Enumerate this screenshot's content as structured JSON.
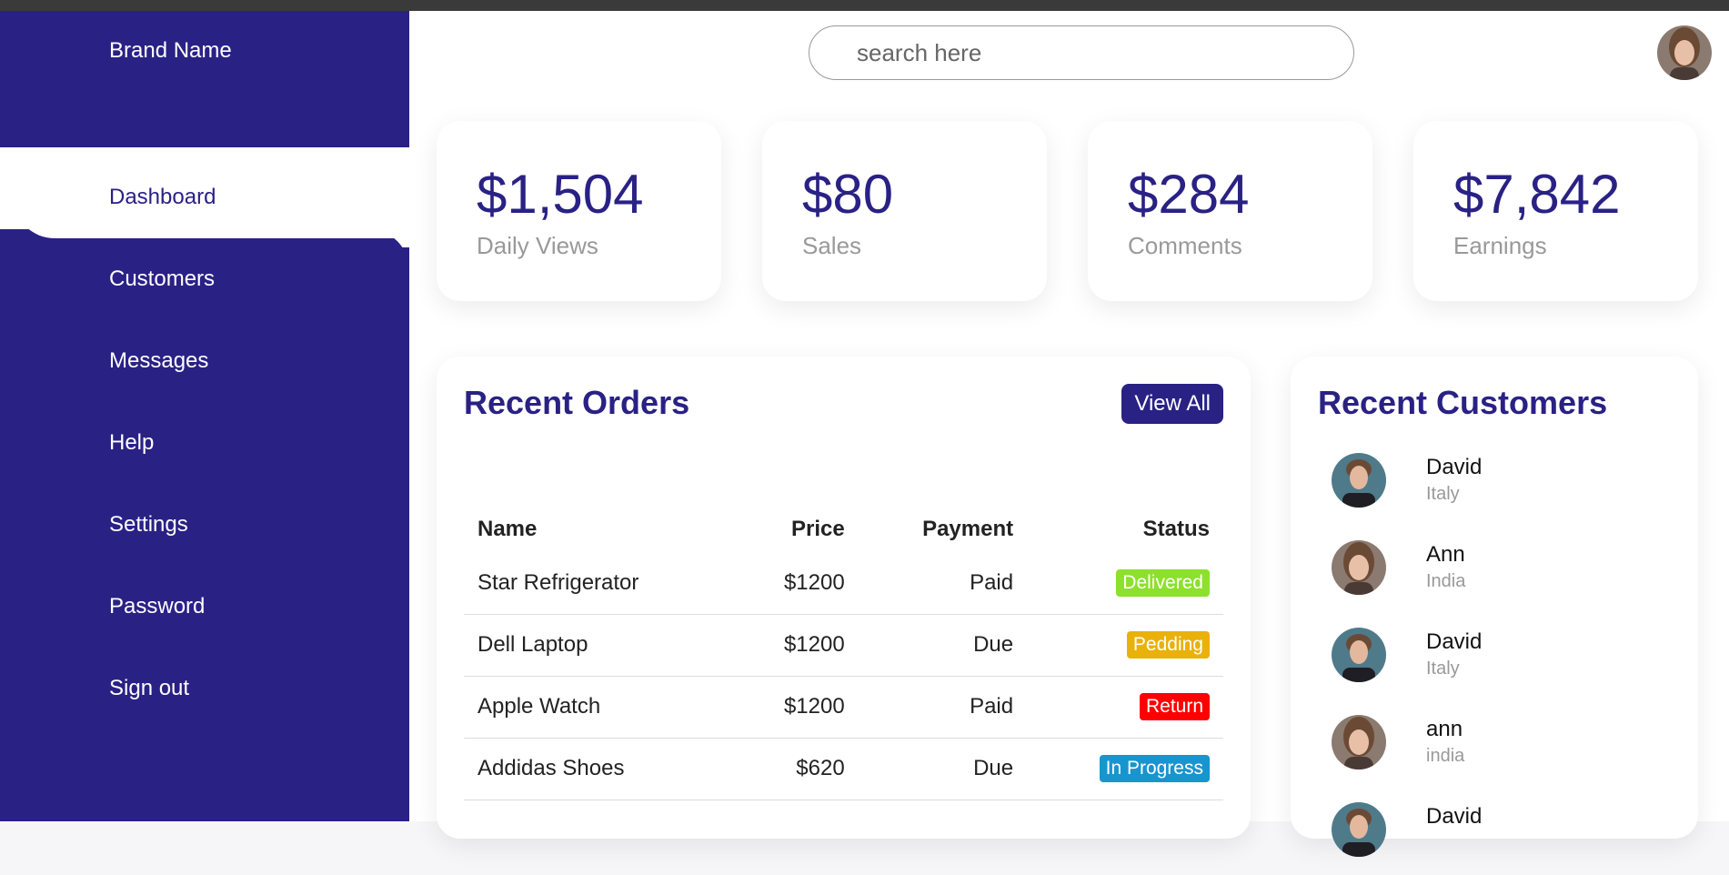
{
  "brand": {
    "name": "Brand Name"
  },
  "sidebar": {
    "items": [
      {
        "label": "Dashboard",
        "active": true
      },
      {
        "label": "Customers"
      },
      {
        "label": "Messages"
      },
      {
        "label": "Help"
      },
      {
        "label": "Settings"
      },
      {
        "label": "Password"
      },
      {
        "label": "Sign out"
      }
    ]
  },
  "search": {
    "placeholder": "search here"
  },
  "cards": [
    {
      "number": "$1,504",
      "label": "Daily Views"
    },
    {
      "number": "$80",
      "label": "Sales"
    },
    {
      "number": "$284",
      "label": "Comments"
    },
    {
      "number": "$7,842",
      "label": "Earnings"
    }
  ],
  "orders": {
    "title": "Recent Orders",
    "view_all": "View All",
    "headers": {
      "name": "Name",
      "price": "Price",
      "payment": "Payment",
      "status": "Status"
    },
    "rows": [
      {
        "name": "Star Refrigerator",
        "price": "$1200",
        "payment": "Paid",
        "status": "Delivered",
        "status_color": "#8de02c"
      },
      {
        "name": "Dell Laptop",
        "price": "$1200",
        "payment": "Due",
        "status": "Pedding",
        "status_color": "#e9b10a"
      },
      {
        "name": "Apple Watch",
        "price": "$1200",
        "payment": "Paid",
        "status": "Return",
        "status_color": "#f00"
      },
      {
        "name": "Addidas Shoes",
        "price": "$620",
        "payment": "Due",
        "status": "In Progress",
        "status_color": "#1795ce"
      }
    ]
  },
  "customers": {
    "title": "Recent Customers",
    "list": [
      {
        "name": "David",
        "country": "Italy",
        "avatar": "male"
      },
      {
        "name": "Ann",
        "country": "India",
        "avatar": "female"
      },
      {
        "name": "David",
        "country": "Italy",
        "avatar": "male"
      },
      {
        "name": "ann",
        "country": "india",
        "avatar": "female"
      },
      {
        "name": "David",
        "country": "",
        "avatar": "male"
      }
    ]
  },
  "colors": {
    "brand": "#2a2185",
    "white": "#ffffff"
  }
}
